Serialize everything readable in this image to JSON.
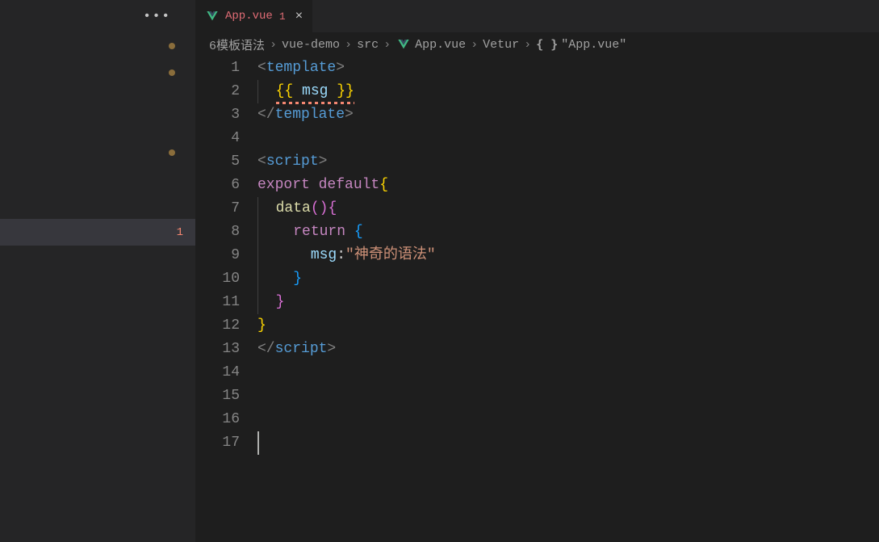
{
  "sidebar": {
    "dots": [
      {
        "visible": true
      },
      {
        "visible": true
      },
      {
        "visible": false
      },
      {
        "visible": false
      },
      {
        "visible": true
      },
      {
        "visible": false
      },
      {
        "visible": false
      }
    ],
    "active_badge": "1"
  },
  "tab": {
    "filename": "App.vue",
    "problem_count": "1",
    "close": "×"
  },
  "breadcrumbs": {
    "items": [
      "6模板语法",
      "vue-demo",
      "src",
      "App.vue",
      "Vetur",
      "\"App.vue\""
    ]
  },
  "code": {
    "lines": [
      {
        "num": "1",
        "tokens": [
          {
            "t": "<",
            "c": "c-bracket"
          },
          {
            "t": "template",
            "c": "c-tag"
          },
          {
            "t": ">",
            "c": "c-bracket"
          }
        ]
      },
      {
        "num": "2",
        "indent": 1,
        "mustache": true,
        "tokens": [
          {
            "t": "{{ ",
            "c": "c-brace-y"
          },
          {
            "t": "msg",
            "c": "c-var"
          },
          {
            "t": " }}",
            "c": "c-brace-y"
          }
        ]
      },
      {
        "num": "3",
        "tokens": [
          {
            "t": "</",
            "c": "c-bracket"
          },
          {
            "t": "template",
            "c": "c-tag"
          },
          {
            "t": ">",
            "c": "c-bracket"
          }
        ]
      },
      {
        "num": "4",
        "tokens": []
      },
      {
        "num": "5",
        "tokens": [
          {
            "t": "<",
            "c": "c-bracket"
          },
          {
            "t": "script",
            "c": "c-tag"
          },
          {
            "t": ">",
            "c": "c-bracket"
          }
        ]
      },
      {
        "num": "6",
        "tokens": [
          {
            "t": "export ",
            "c": "c-keyword"
          },
          {
            "t": "default",
            "c": "c-keyword"
          },
          {
            "t": "{",
            "c": "c-brace-y"
          }
        ]
      },
      {
        "num": "7",
        "indent": 1,
        "tokens": [
          {
            "t": "data",
            "c": "c-prop"
          },
          {
            "t": "()",
            "c": "c-brace-p"
          },
          {
            "t": "{",
            "c": "c-brace-p"
          }
        ]
      },
      {
        "num": "8",
        "indent": 2,
        "tokens": [
          {
            "t": "return",
            "c": "c-keyword"
          },
          {
            "t": " {",
            "c": "c-brace-b"
          }
        ]
      },
      {
        "num": "9",
        "indent": 3,
        "tokens": [
          {
            "t": "msg",
            "c": "c-var"
          },
          {
            "t": ":",
            "c": "c-default"
          },
          {
            "t": "\"神奇的语法\"",
            "c": "c-string"
          }
        ]
      },
      {
        "num": "10",
        "indent": 2,
        "tokens": [
          {
            "t": "}",
            "c": "c-brace-b"
          }
        ]
      },
      {
        "num": "11",
        "indent": 1,
        "tokens": [
          {
            "t": "}",
            "c": "c-brace-p"
          }
        ]
      },
      {
        "num": "12",
        "tokens": [
          {
            "t": "}",
            "c": "c-brace-y"
          }
        ]
      },
      {
        "num": "13",
        "tokens": [
          {
            "t": "</",
            "c": "c-bracket"
          },
          {
            "t": "script",
            "c": "c-tag"
          },
          {
            "t": ">",
            "c": "c-bracket"
          }
        ]
      },
      {
        "num": "14",
        "tokens": []
      },
      {
        "num": "15",
        "tokens": []
      },
      {
        "num": "16",
        "tokens": []
      },
      {
        "num": "17",
        "tokens": [],
        "cursor": true
      }
    ],
    "indent_size": "  "
  }
}
